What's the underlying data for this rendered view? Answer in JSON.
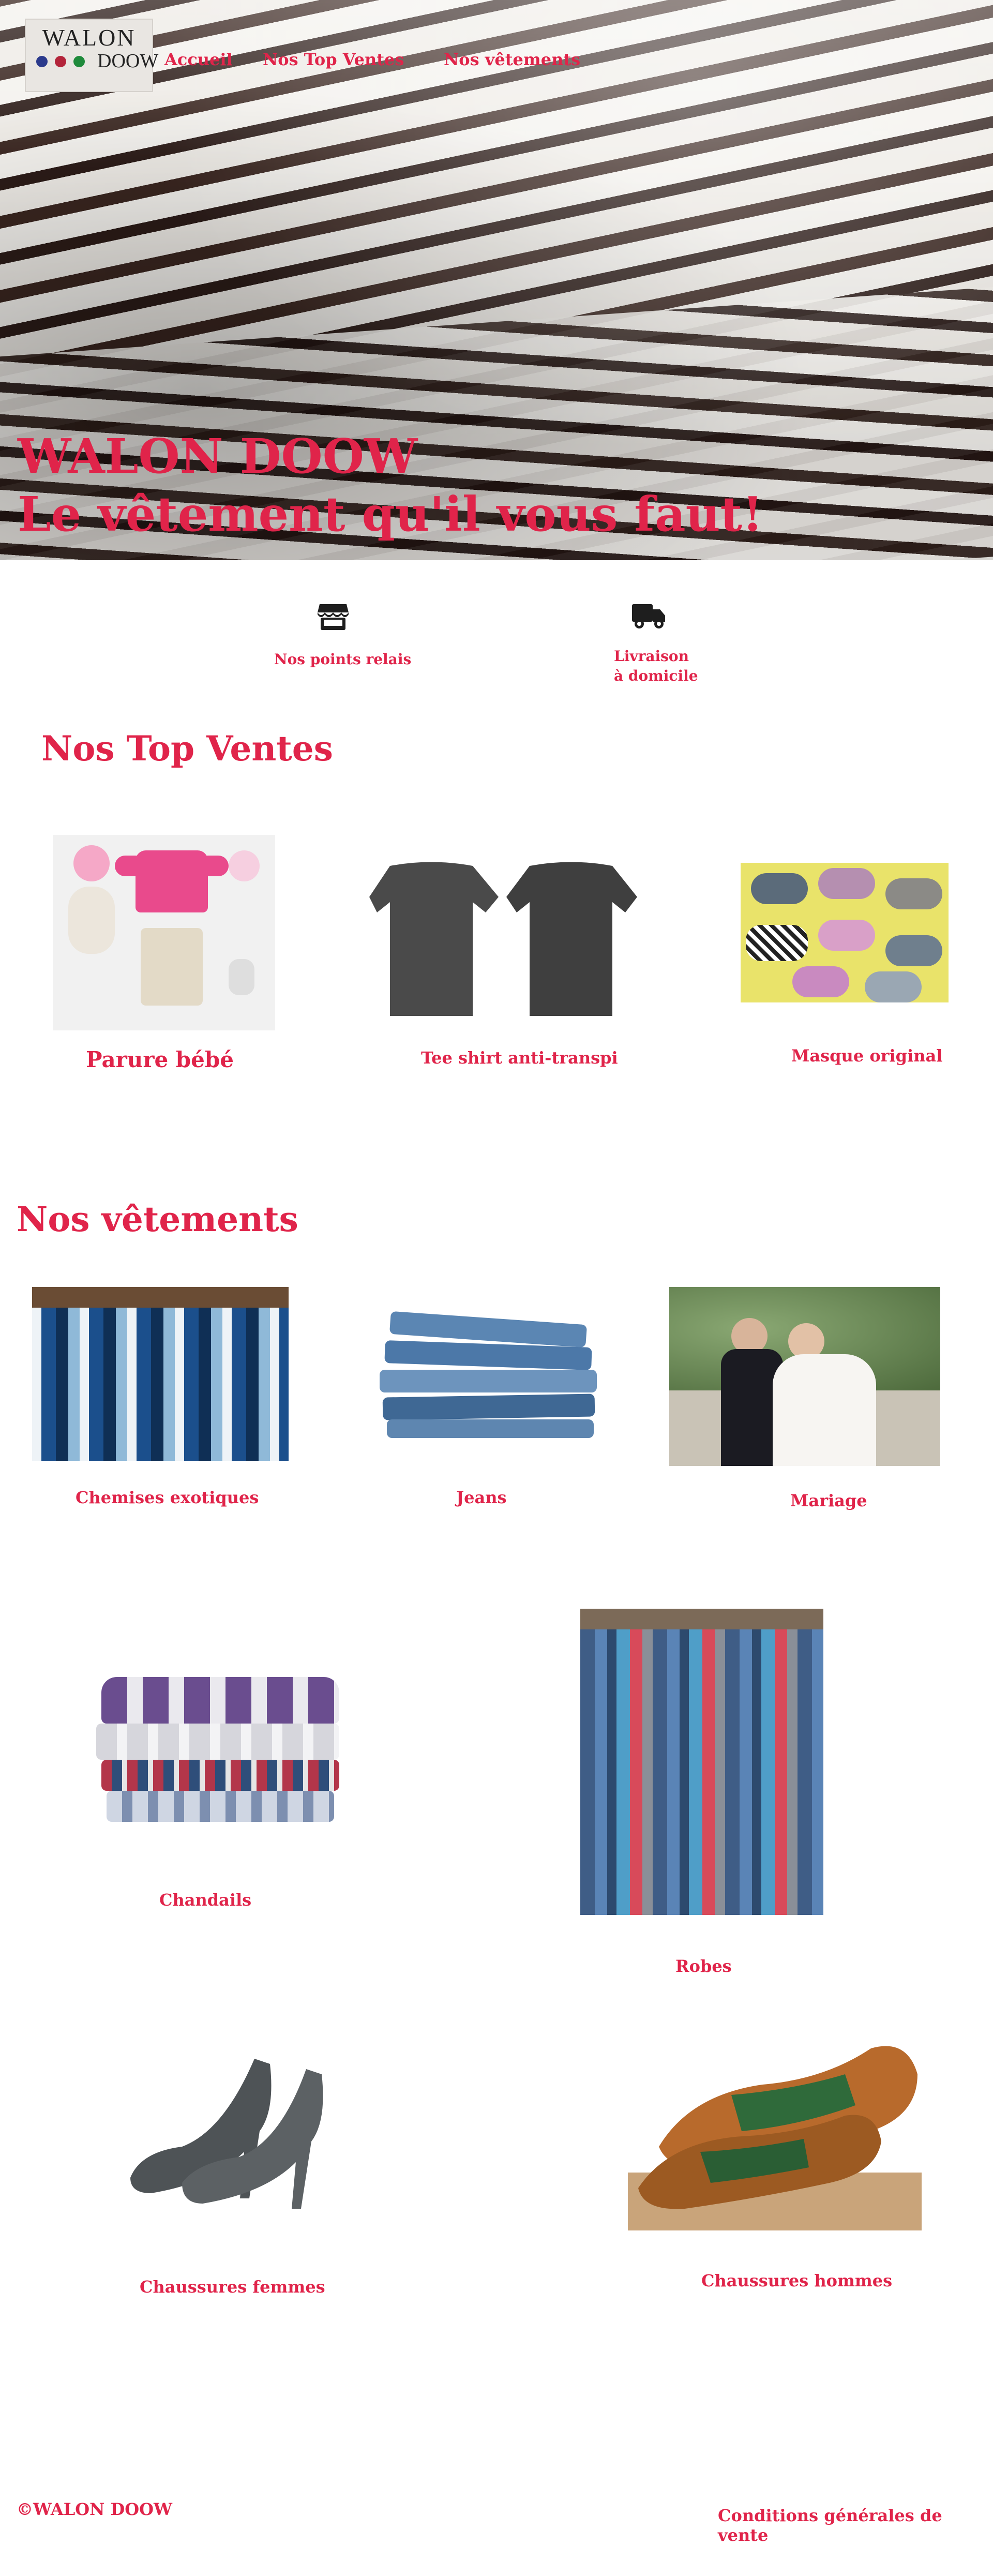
{
  "brand": {
    "logo_top": "WALON",
    "logo_bottom": "DOOW",
    "dot_colors": [
      "#2b3a8c",
      "#b3243a",
      "#1f8a3b"
    ]
  },
  "nav": {
    "home": "Accueil",
    "top_sales": "Nos Top Ventes",
    "clothes": "Nos vêtements"
  },
  "hero": {
    "line1": "WALON DOOW",
    "line2": "Le vêtement qu'il vous faut!"
  },
  "features": {
    "relay": "Nos points relais",
    "delivery_line1": "Livraison",
    "delivery_line2": "à domicile",
    "icons": [
      "store-icon",
      "truck-icon"
    ]
  },
  "top_sales": {
    "title": "Nos Top Ventes",
    "items": [
      {
        "label": "Parure bébé"
      },
      {
        "label": "Tee shirt anti-transpi"
      },
      {
        "label": "Masque original"
      }
    ]
  },
  "clothes": {
    "title": "Nos vêtements",
    "items": [
      {
        "label": "Chemises exotiques"
      },
      {
        "label": "Jeans"
      },
      {
        "label": "Mariage"
      },
      {
        "label": "Chandails"
      },
      {
        "label": "Robes"
      },
      {
        "label": "Chaussures femmes"
      },
      {
        "label": "Chaussures hommes"
      }
    ]
  },
  "footer": {
    "copyright": "©WALON DOOW",
    "terms": "Conditions générales de vente"
  },
  "colors": {
    "accent": "#e0244a"
  }
}
